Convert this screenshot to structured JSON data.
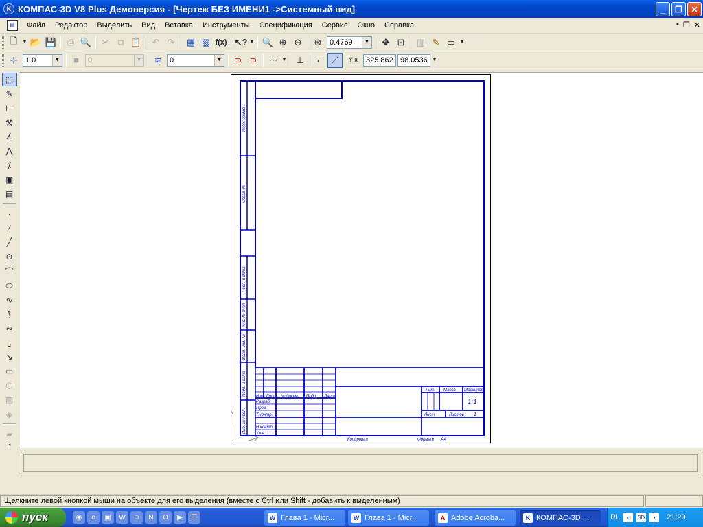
{
  "window": {
    "title": "КОМПАС-3D V8 Plus Демоверсия - [Чертеж БЕЗ ИМЕНИ1 ->Системный вид]",
    "app_icon": "kompas-logo-icon"
  },
  "menu": {
    "items": [
      "Файл",
      "Редактор",
      "Выделить",
      "Вид",
      "Вставка",
      "Инструменты",
      "Спецификация",
      "Сервис",
      "Окно",
      "Справка"
    ]
  },
  "toolbar1": {
    "zoom_value": "0.4769"
  },
  "toolbar2": {
    "step_value": "1.0",
    "style_value": "0",
    "layer_value": "0",
    "coord_label": "Y x",
    "coord_x": "325.862",
    "coord_y": "98.0536"
  },
  "drawing": {
    "stamp": {
      "razrab": "Разраб.",
      "prov": "Пров.",
      "tkontr": "Т.контр.",
      "nkontr": "Н.контр.",
      "utv": "Утв.",
      "izm": "Изм. Лист",
      "ndokum": "№ докум.",
      "podp": "Подп.",
      "data": "Дата",
      "lit": "Лит.",
      "massa": "Масса",
      "masshtab": "Масштаб",
      "scale": "1:1",
      "list": "Лист",
      "listov": "Листов",
      "listov_value": "1",
      "kopiroval": "Копировал",
      "format": "Формат",
      "format_value": "A4"
    },
    "side": {
      "perv_primen": "Перв. примен.",
      "sprav": "Справ. №",
      "podp_data_1": "Подп. и дата",
      "inv_dubl": "Инв. № дубл.",
      "vzam_inv": "Взам. инв. №",
      "podp_data_2": "Подп. и дата",
      "inv_podl": "Инв. № подл."
    }
  },
  "status": {
    "message": "Щелкните левой кнопкой мыши на объекте для его выделения (вместе с Ctrl или Shift - добавить к выделенным)"
  },
  "taskbar": {
    "start_label": "пуск",
    "tasks": [
      {
        "label": "Глава 1 - Micr...",
        "icon": "word-icon"
      },
      {
        "label": "Глава 1 - Micr...",
        "icon": "word-icon"
      },
      {
        "label": "Adobe Acroba...",
        "icon": "acrobat-icon"
      },
      {
        "label": "КОМПАС-3D ...",
        "icon": "kompas-icon"
      }
    ],
    "lang": "RL",
    "clock": "21:29"
  }
}
